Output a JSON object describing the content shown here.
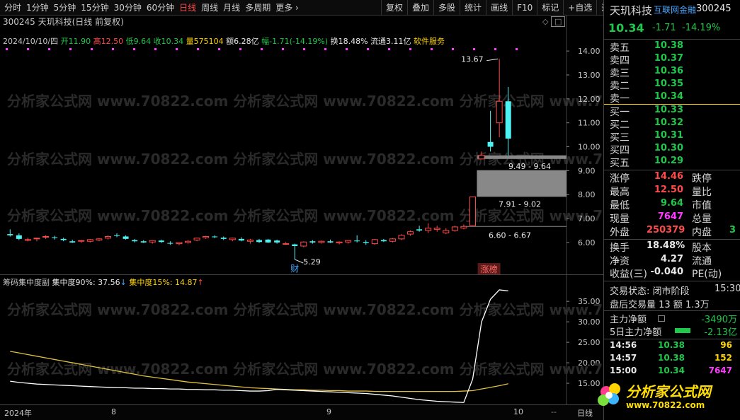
{
  "toolbar": {
    "periods": [
      "分时",
      "1分钟",
      "5分钟",
      "15分钟",
      "30分钟",
      "60分钟",
      "日线",
      "周线",
      "月线",
      "多周期",
      "更多"
    ],
    "active_period": "日线",
    "tools": [
      "复权",
      "叠加",
      "多股",
      "统计",
      "画线",
      "F10",
      "标记",
      "+自选",
      "返回"
    ]
  },
  "chart": {
    "title": "300245 天玑科技(日线 前复权)",
    "date": "2024/10/10/四",
    "open_label": "开",
    "open": "11.90",
    "high_label": "高",
    "high": "12.50",
    "low_label": "低",
    "low": "9.64",
    "close_label": "收",
    "close": "10.34",
    "volume_label": "量",
    "volume": "575104",
    "amount_label": "额",
    "amount": "6.28亿",
    "change_label": "幅",
    "change": "-1.71(-14.19%)",
    "turnover_label": "换",
    "turnover": "18.48%",
    "float_label": "流通",
    "float_cap": "3.11亿",
    "sector": "软件服务",
    "price_ticks": [
      "14.00",
      "13.00",
      "12.00",
      "11.00",
      "10.00",
      "9.00",
      "8.00",
      "7.00",
      "6.00"
    ],
    "annotations": {
      "high_marker": "13.67",
      "low_marker": "5.29",
      "gap1": "9.49 - 9.64",
      "gap2": "7.91 - 9.02",
      "gap3": "6.60 - 6.67",
      "fin_tag": "财",
      "limit_tag": "涨榜"
    },
    "watermark": "分析家公式网 www.70822.com"
  },
  "indicator": {
    "name": "筹码集中度副",
    "line1_label": "集中度90%:",
    "line1_value": "37.56",
    "line2_label": "集中度15%:",
    "line2_value": "14.87",
    "ticks": [
      "35.00",
      "30.00",
      "25.00",
      "20.00",
      "15.00"
    ],
    "color1": "#ffffff",
    "color2": "#e0c040"
  },
  "time_axis": {
    "labels": [
      "2024年",
      "8",
      "9",
      "10"
    ],
    "corner": "日线"
  },
  "quote": {
    "name": "天玑科技",
    "source": "互联网金融",
    "code": "300245",
    "price": "10.34",
    "change": "-1.71",
    "pct": "-14.19%",
    "asks": [
      {
        "label": "卖五",
        "price": "10.38"
      },
      {
        "label": "卖四",
        "price": "10.37"
      },
      {
        "label": "卖三",
        "price": "10.36"
      },
      {
        "label": "卖二",
        "price": "10.35"
      },
      {
        "label": "卖一",
        "price": "10.34"
      }
    ],
    "bids": [
      {
        "label": "买一",
        "price": "10.33"
      },
      {
        "label": "买二",
        "price": "10.32"
      },
      {
        "label": "买三",
        "price": "10.31"
      },
      {
        "label": "买四",
        "price": "10.30"
      },
      {
        "label": "买五",
        "price": "10.29"
      }
    ],
    "stats": {
      "limit_up_label": "涨停",
      "limit_up": "14.46",
      "limit_down_label": "跌停",
      "high_label": "最高",
      "high": "12.50",
      "vol_ratio_label": "量比",
      "low_label": "最低",
      "low": "9.64",
      "mkt_cap_label": "市值",
      "cur_vol_label": "现量",
      "cur_vol": "7647",
      "total_vol_label": "总量",
      "outer_label": "外盘",
      "outer": "250379",
      "inner_label": "内盘",
      "inner": "3",
      "turnover_label": "换手",
      "turnover": "18.48%",
      "equity_label": "股本",
      "nav_label": "净资",
      "nav": "4.27",
      "float_label": "流通",
      "eps_label": "收益(三)",
      "eps": "-0.040",
      "pe_label": "PE(动)"
    },
    "trade_status": "交易状态: 闭市阶段",
    "trade_time": "15:30",
    "after_hours": "盘后交易量 13 额 1.3万",
    "main_net_label": "主力净额",
    "main_net": "-3490万",
    "main5_label": "5日主力净额",
    "main5": "-2.13亿",
    "ticks": [
      {
        "time": "14:56",
        "price": "10.38",
        "vol": "96"
      },
      {
        "time": "14:57",
        "price": "10.38",
        "vol": "152"
      },
      {
        "time": "15:00",
        "price": "10.34",
        "vol": "7647"
      }
    ]
  },
  "badge": {
    "text": "分析家公式网",
    "url": "www.70822.com"
  },
  "chart_data": {
    "type": "candlestick",
    "title": "300245 天玑科技(日线 前复权)",
    "ylim": [
      5.2,
      14.3
    ],
    "candles": [
      [
        6.35,
        6.55,
        6.25,
        6.3
      ],
      [
        6.3,
        6.38,
        6.1,
        6.15
      ],
      [
        6.1,
        6.2,
        6.05,
        6.12
      ],
      [
        6.15,
        6.2,
        6.05,
        6.18
      ],
      [
        6.25,
        6.3,
        6.15,
        6.25
      ],
      [
        6.22,
        6.28,
        6.12,
        6.2
      ],
      [
        6.15,
        6.2,
        6.05,
        6.1
      ],
      [
        6.05,
        6.12,
        5.98,
        6.0
      ],
      [
        6.05,
        6.1,
        5.98,
        6.08
      ],
      [
        6.05,
        6.15,
        6.0,
        6.12
      ],
      [
        6.1,
        6.18,
        6.05,
        6.15
      ],
      [
        6.18,
        6.3,
        6.12,
        6.25
      ],
      [
        6.3,
        6.38,
        6.22,
        6.28
      ],
      [
        6.25,
        6.3,
        6.12,
        6.15
      ],
      [
        6.1,
        6.15,
        6.0,
        6.05
      ],
      [
        6.05,
        6.1,
        5.98,
        6.0
      ],
      [
        6.02,
        6.1,
        5.95,
        6.08
      ],
      [
        6.08,
        6.12,
        5.98,
        6.02
      ],
      [
        5.98,
        6.05,
        5.9,
        5.95
      ],
      [
        5.95,
        6.0,
        5.88,
        6.0
      ],
      [
        6.0,
        6.1,
        5.95,
        6.05
      ],
      [
        6.1,
        6.2,
        6.05,
        6.18
      ],
      [
        6.2,
        6.28,
        6.15,
        6.25
      ],
      [
        6.25,
        6.3,
        6.18,
        6.22
      ],
      [
        6.2,
        6.25,
        6.1,
        6.15
      ],
      [
        6.12,
        6.2,
        6.05,
        6.18
      ],
      [
        6.15,
        6.22,
        6.05,
        6.08
      ],
      [
        6.05,
        6.15,
        5.95,
        6.1
      ],
      [
        6.1,
        6.15,
        5.98,
        6.02
      ],
      [
        6.12,
        6.15,
        5.98,
        6.0
      ],
      [
        6.08,
        6.12,
        5.95,
        6.0
      ],
      [
        5.95,
        6.02,
        5.9,
        5.95
      ],
      [
        5.92,
        5.95,
        5.29,
        5.85
      ],
      [
        5.85,
        6.05,
        5.8,
        6.02
      ],
      [
        6.05,
        6.1,
        5.95,
        6.0
      ],
      [
        6.0,
        6.08,
        5.95,
        6.05
      ],
      [
        6.05,
        6.12,
        5.98,
        6.0
      ],
      [
        5.98,
        6.05,
        5.92,
        6.02
      ],
      [
        6.02,
        6.1,
        5.95,
        6.08
      ],
      [
        6.08,
        6.3,
        6.0,
        6.05
      ],
      [
        6.02,
        6.1,
        5.9,
        5.98
      ],
      [
        5.95,
        6.15,
        5.9,
        6.12
      ],
      [
        6.1,
        6.15,
        6.02,
        6.05
      ],
      [
        6.05,
        6.18,
        6.0,
        6.15
      ],
      [
        6.15,
        6.35,
        6.1,
        6.3
      ],
      [
        6.35,
        6.5,
        6.28,
        6.45
      ],
      [
        6.55,
        6.7,
        6.45,
        6.5
      ],
      [
        6.5,
        6.8,
        6.4,
        6.6
      ],
      [
        6.55,
        6.7,
        6.45,
        6.6
      ],
      [
        6.4,
        6.6,
        6.35,
        6.5
      ],
      [
        6.5,
        6.7,
        6.45,
        6.65
      ],
      [
        6.6,
        6.75,
        6.55,
        6.67
      ],
      [
        6.7,
        7.91,
        6.7,
        7.91
      ],
      [
        9.49,
        9.8,
        9.49,
        9.64
      ],
      [
        10.2,
        11.5,
        9.8,
        10.0
      ],
      [
        11.0,
        13.67,
        10.4,
        11.9
      ],
      [
        11.9,
        12.5,
        9.64,
        10.34
      ]
    ],
    "indicator": {
      "series": [
        {
          "name": "集中度90%",
          "color": "#ffffff"
        },
        {
          "name": "集中度15%",
          "color": "#e0c040"
        }
      ],
      "ylim": [
        10,
        39
      ],
      "conc90": [
        15.5,
        15.2,
        15.0,
        14.8,
        14.7,
        14.6,
        14.5,
        14.4,
        14.3,
        14.2,
        14.1,
        14.0,
        13.9,
        13.9,
        13.8,
        13.8,
        13.7,
        13.7,
        13.6,
        13.6,
        13.5,
        13.5,
        13.4,
        13.4,
        13.3,
        13.3,
        13.2,
        13.1,
        13.1,
        13.2,
        13.5,
        13.4,
        13.3,
        13.2,
        13.1,
        13.0,
        12.9,
        12.8,
        12.7,
        12.6,
        12.5,
        12.3,
        12.1,
        11.9,
        11.6,
        11.3,
        11.0,
        10.8,
        10.6,
        10.5,
        10.4,
        10.3,
        16.0,
        30.0,
        35.5,
        37.8,
        37.56
      ],
      "conc15": [
        22.8,
        22.4,
        22.0,
        21.6,
        21.2,
        20.8,
        20.4,
        20.0,
        19.6,
        19.2,
        18.8,
        18.4,
        18.0,
        17.6,
        17.2,
        16.8,
        16.5,
        16.2,
        15.9,
        15.6,
        15.3,
        15.1,
        14.9,
        14.7,
        14.5,
        14.3,
        14.1,
        13.9,
        13.8,
        13.7,
        13.6,
        13.5,
        13.4,
        13.4,
        13.3,
        13.3,
        13.2,
        13.2,
        13.1,
        13.1,
        13.1,
        13.0,
        13.0,
        13.0,
        13.0,
        13.0,
        13.0,
        13.0,
        13.0,
        13.0,
        13.0,
        13.1,
        13.2,
        13.6,
        14.0,
        14.4,
        14.87
      ]
    }
  }
}
